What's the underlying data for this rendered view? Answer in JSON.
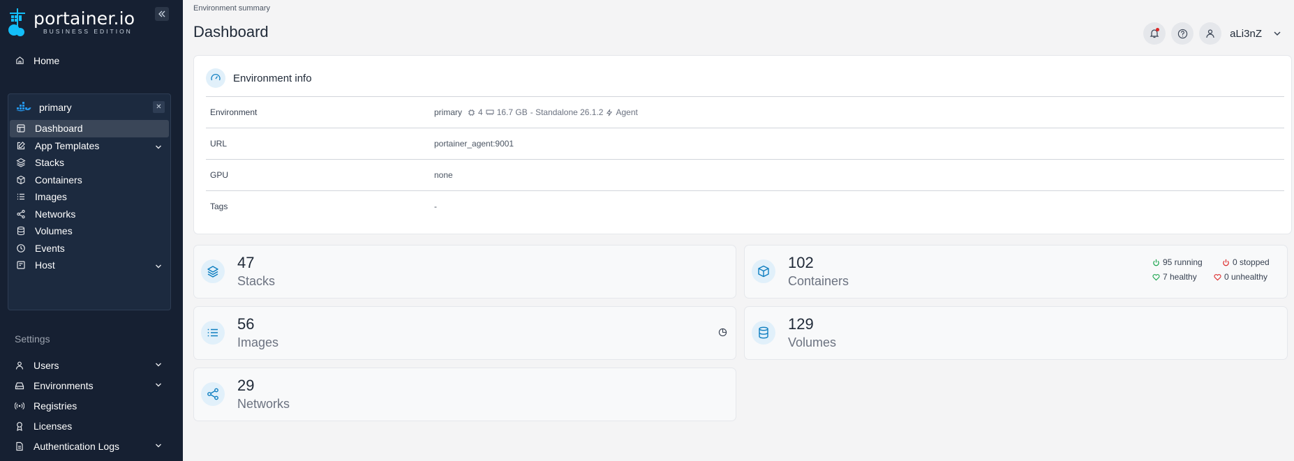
{
  "brand": {
    "name": "portainer.io",
    "edition": "BUSINESS EDITION"
  },
  "sidebar": {
    "home": "Home",
    "environment": {
      "name": "primary",
      "items": [
        {
          "label": "Dashboard",
          "icon": "dashboard-icon",
          "active": true
        },
        {
          "label": "App Templates",
          "icon": "edit-icon",
          "expand": true
        },
        {
          "label": "Stacks",
          "icon": "layers-icon"
        },
        {
          "label": "Containers",
          "icon": "box-icon"
        },
        {
          "label": "Images",
          "icon": "list-icon"
        },
        {
          "label": "Networks",
          "icon": "share-icon"
        },
        {
          "label": "Volumes",
          "icon": "database-icon"
        },
        {
          "label": "Events",
          "icon": "clock-icon"
        },
        {
          "label": "Host",
          "icon": "host-icon",
          "expand": true
        }
      ]
    },
    "settings_label": "Settings",
    "settings_items": [
      {
        "label": "Users",
        "icon": "user-icon",
        "expand": true
      },
      {
        "label": "Environments",
        "icon": "hdd-icon",
        "expand": true
      },
      {
        "label": "Registries",
        "icon": "radio-icon"
      },
      {
        "label": "Licenses",
        "icon": "award-icon"
      },
      {
        "label": "Authentication Logs",
        "icon": "file-icon",
        "expand": true
      }
    ]
  },
  "header": {
    "breadcrumb": "Environment summary",
    "title": "Dashboard",
    "user": "aLi3nZ"
  },
  "env_info": {
    "title": "Environment info",
    "rows": {
      "environment": {
        "key": "Environment",
        "name": "primary",
        "cpu": "4",
        "memory": "16.7 GB",
        "type": "- Standalone 26.1.2",
        "agent": "Agent"
      },
      "url": {
        "key": "URL",
        "value": "portainer_agent:9001"
      },
      "gpu": {
        "key": "GPU",
        "value": "none"
      },
      "tags": {
        "key": "Tags",
        "value": "-"
      }
    }
  },
  "stats": {
    "stacks": {
      "count": "47",
      "label": "Stacks"
    },
    "containers": {
      "count": "102",
      "label": "Containers",
      "running": "95 running",
      "stopped": "0 stopped",
      "healthy": "7 healthy",
      "unhealthy": "0 unhealthy"
    },
    "images": {
      "count": "56",
      "label": "Images"
    },
    "volumes": {
      "count": "129",
      "label": "Volumes"
    },
    "networks": {
      "count": "29",
      "label": "Networks"
    }
  },
  "colors": {
    "sidebar": "#162032",
    "accent": "#0e7ec0",
    "running": "#16a34a",
    "stopped": "#dc2626"
  }
}
